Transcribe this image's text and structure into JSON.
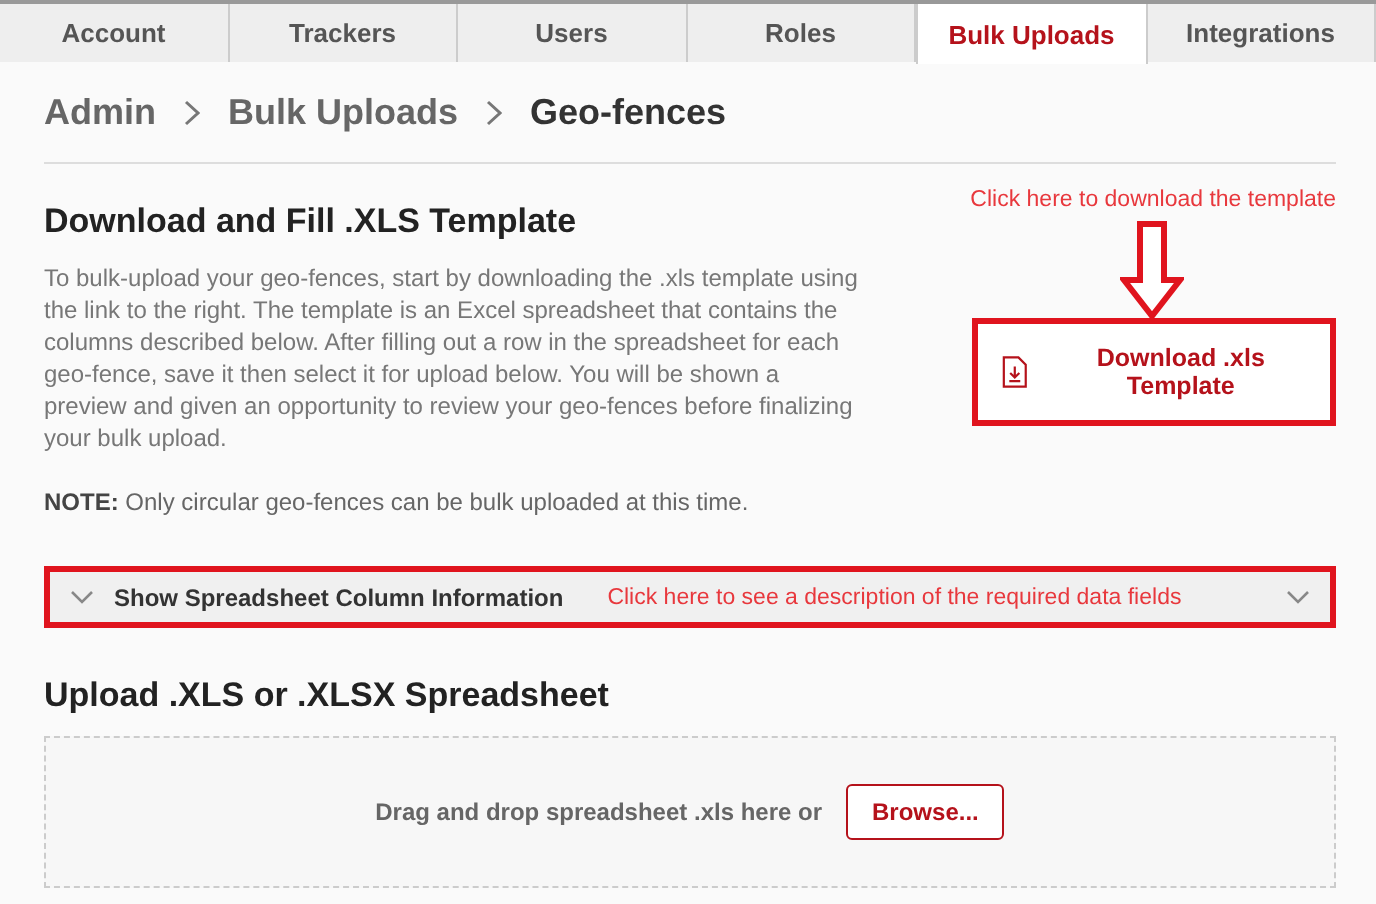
{
  "tabs": [
    {
      "label": "Account",
      "selected": false
    },
    {
      "label": "Trackers",
      "selected": false
    },
    {
      "label": "Users",
      "selected": false
    },
    {
      "label": "Roles",
      "selected": false
    },
    {
      "label": "Bulk Uploads",
      "selected": true
    },
    {
      "label": "Integrations",
      "selected": false
    }
  ],
  "breadcrumb": [
    "Admin",
    "Bulk Uploads",
    "Geo-fences"
  ],
  "download_section": {
    "heading": "Download and Fill .XLS Template",
    "description": "To bulk-upload your geo-fences, start by downloading the .xls template using the link to the right. The template is an Excel spreadsheet that contains the columns described below. After filling out a row in the spreadsheet for each geo-fence, save it then select it for upload below. You will be shown a preview and given an opportunity to review your geo-fences before finalizing your bulk upload.",
    "note": "**NOTE:** Only circular geo-fences can be bulk uploaded at this time.",
    "annotation": "Click here to download the template",
    "button": "Download .xls Template"
  },
  "column_info": {
    "label": "Show Spreadsheet Column Information",
    "expanded": false,
    "annotation": "Click here to see a description of the required data fields"
  },
  "upload_section": {
    "heading": "Upload .XLS or .XLSX Spreadsheet",
    "dropzone_text": "Drag and drop spreadsheet .xls here or",
    "button": "Browse..."
  }
}
